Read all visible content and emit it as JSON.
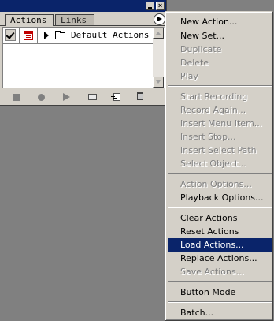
{
  "panel": {
    "tabs": [
      "Actions",
      "Links"
    ],
    "action_set": "Default Actions"
  },
  "menu": {
    "items": [
      {
        "label": "New Action...",
        "enabled": true
      },
      {
        "label": "New Set...",
        "enabled": true
      },
      {
        "label": "Duplicate",
        "enabled": false
      },
      {
        "label": "Delete",
        "enabled": false
      },
      {
        "label": "Play",
        "enabled": false
      },
      {
        "label": "Start Recording",
        "enabled": false
      },
      {
        "label": "Record Again...",
        "enabled": false
      },
      {
        "label": "Insert Menu Item...",
        "enabled": false
      },
      {
        "label": "Insert Stop...",
        "enabled": false
      },
      {
        "label": "Insert Select Path",
        "enabled": false
      },
      {
        "label": "Select Object...",
        "enabled": false
      },
      {
        "label": "Action Options...",
        "enabled": false
      },
      {
        "label": "Playback Options...",
        "enabled": true
      },
      {
        "label": "Clear Actions",
        "enabled": true
      },
      {
        "label": "Reset Actions",
        "enabled": true
      },
      {
        "label": "Load Actions...",
        "enabled": true,
        "selected": true
      },
      {
        "label": "Replace Actions...",
        "enabled": true
      },
      {
        "label": "Save Actions...",
        "enabled": false
      },
      {
        "label": "Button Mode",
        "enabled": true
      },
      {
        "label": "Batch...",
        "enabled": true
      }
    ]
  },
  "colors": {
    "selection": "#0a246a",
    "menu_bg": "#d4d0c8",
    "disabled_text": "#808080"
  }
}
